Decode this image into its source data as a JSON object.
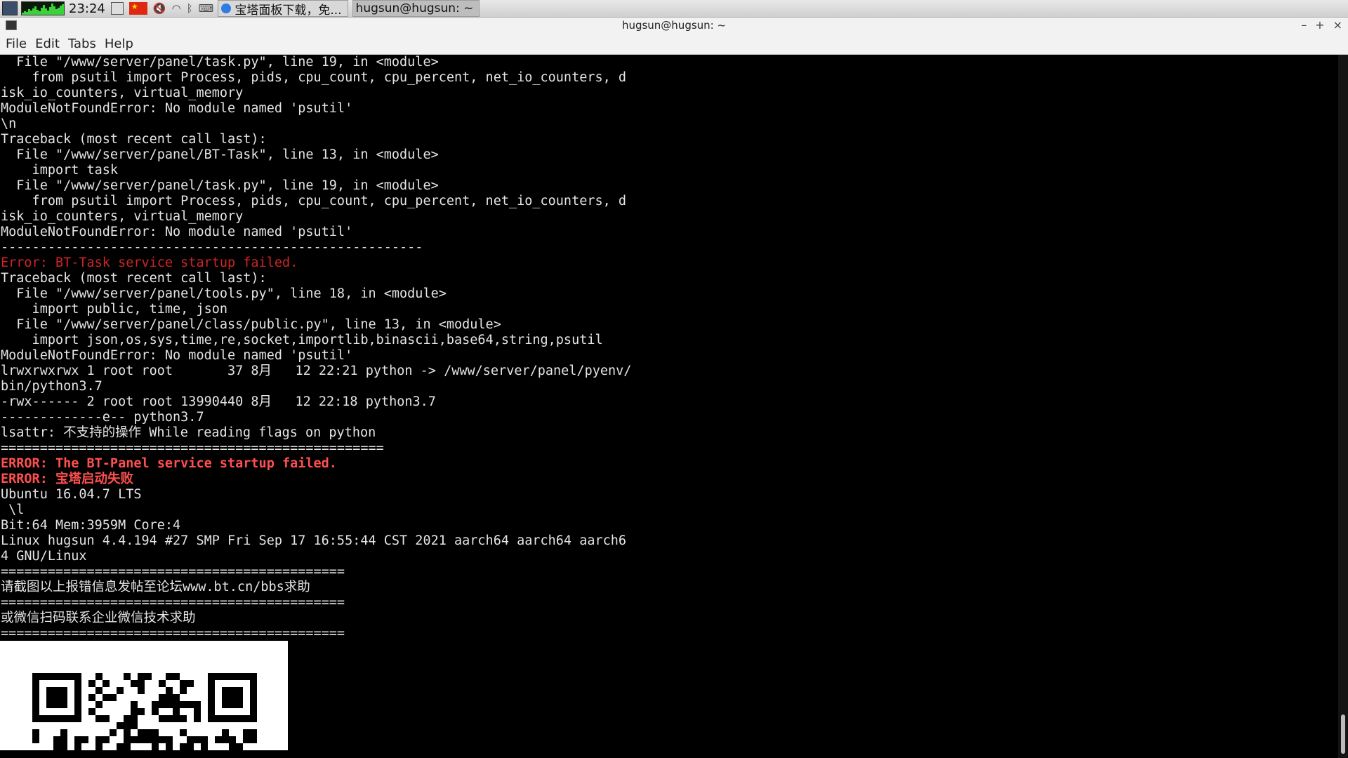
{
  "panel": {
    "clock": "23:24",
    "tasks": [
      {
        "label": "宝塔面板下载，免..."
      },
      {
        "label": "hugsun@hugsun: ~"
      }
    ]
  },
  "window": {
    "title": "hugsun@hugsun: ~",
    "controls": [
      "–",
      "+",
      "×"
    ]
  },
  "menu": [
    "File",
    "Edit",
    "Tabs",
    "Help"
  ],
  "terminal": {
    "lines": [
      {
        "text": "  File \"/www/server/panel/task.py\", line 19, in <module>",
        "style": ""
      },
      {
        "text": "    from psutil import Process, pids, cpu_count, cpu_percent, net_io_counters, d",
        "style": ""
      },
      {
        "text": "isk_io_counters, virtual_memory",
        "style": ""
      },
      {
        "text": "ModuleNotFoundError: No module named 'psutil'",
        "style": ""
      },
      {
        "text": "\\n",
        "style": ""
      },
      {
        "text": "Traceback (most recent call last):",
        "style": ""
      },
      {
        "text": "  File \"/www/server/panel/BT-Task\", line 13, in <module>",
        "style": ""
      },
      {
        "text": "    import task",
        "style": ""
      },
      {
        "text": "  File \"/www/server/panel/task.py\", line 19, in <module>",
        "style": ""
      },
      {
        "text": "    from psutil import Process, pids, cpu_count, cpu_percent, net_io_counters, d",
        "style": ""
      },
      {
        "text": "isk_io_counters, virtual_memory",
        "style": ""
      },
      {
        "text": "ModuleNotFoundError: No module named 'psutil'",
        "style": ""
      },
      {
        "text": "------------------------------------------------------",
        "style": ""
      },
      {
        "text": "Error: BT-Task service startup failed.",
        "style": "red"
      },
      {
        "text": "Traceback (most recent call last):",
        "style": ""
      },
      {
        "text": "  File \"/www/server/panel/tools.py\", line 18, in <module>",
        "style": ""
      },
      {
        "text": "    import public, time, json",
        "style": ""
      },
      {
        "text": "  File \"/www/server/panel/class/public.py\", line 13, in <module>",
        "style": ""
      },
      {
        "text": "    import json,os,sys,time,re,socket,importlib,binascii,base64,string,psutil",
        "style": ""
      },
      {
        "text": "ModuleNotFoundError: No module named 'psutil'",
        "style": ""
      },
      {
        "text": "lrwxrwxrwx 1 root root       37 8月   12 22:21 python -> /www/server/panel/pyenv/",
        "style": ""
      },
      {
        "text": "bin/python3.7",
        "style": ""
      },
      {
        "text": "-rwx------ 2 root root 13990440 8月   12 22:18 python3.7",
        "style": ""
      },
      {
        "text": "-------------e-- python3.7",
        "style": ""
      },
      {
        "text": "lsattr: 不支持的操作 While reading flags on python",
        "style": ""
      },
      {
        "text": "=================================================",
        "style": ""
      },
      {
        "text": "ERROR: The BT-Panel service startup failed.",
        "style": "bold-red"
      },
      {
        "text": "ERROR: 宝塔启动失败",
        "style": "bold-red"
      },
      {
        "text": "Ubuntu 16.04.7 LTS",
        "style": ""
      },
      {
        "text": " \\l",
        "style": ""
      },
      {
        "text": "Bit:64 Mem:3959M Core:4",
        "style": ""
      },
      {
        "text": "Linux hugsun 4.4.194 #27 SMP Fri Sep 17 16:55:44 CST 2021 aarch64 aarch64 aarch6",
        "style": ""
      },
      {
        "text": "4 GNU/Linux",
        "style": ""
      },
      {
        "text": "============================================",
        "style": ""
      },
      {
        "text": "请截图以上报错信息发帖至论坛www.bt.cn/bbs求助",
        "style": ""
      },
      {
        "text": "============================================",
        "style": ""
      },
      {
        "text": "或微信扫码联系企业微信技术求助",
        "style": ""
      },
      {
        "text": "============================================",
        "style": ""
      }
    ]
  }
}
